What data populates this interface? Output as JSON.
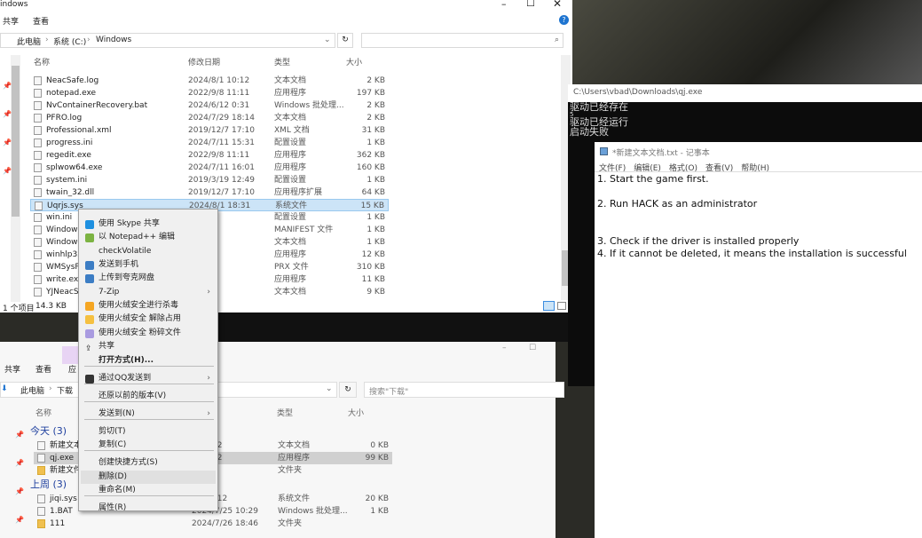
{
  "top_explorer": {
    "title": "indows",
    "ribbon_tabs": [
      "共享",
      "查看"
    ],
    "breadcrumb": [
      "此电脑",
      "系统 (C:)",
      "Windows"
    ],
    "columns": {
      "name": "名称",
      "date": "修改日期",
      "type": "类型",
      "size": "大小"
    },
    "files": [
      {
        "name": "NeacSafe.log",
        "date": "2024/8/1 10:12",
        "type": "文本文档",
        "size": "2 KB"
      },
      {
        "name": "notepad.exe",
        "date": "2022/9/8 11:11",
        "type": "应用程序",
        "size": "197 KB"
      },
      {
        "name": "NvContainerRecovery.bat",
        "date": "2024/6/12 0:31",
        "type": "Windows 批处理...",
        "size": "2 KB"
      },
      {
        "name": "PFRO.log",
        "date": "2024/7/29 18:14",
        "type": "文本文档",
        "size": "2 KB"
      },
      {
        "name": "Professional.xml",
        "date": "2019/12/7 17:10",
        "type": "XML 文档",
        "size": "31 KB"
      },
      {
        "name": "progress.ini",
        "date": "2024/7/11 15:31",
        "type": "配置设置",
        "size": "1 KB"
      },
      {
        "name": "regedit.exe",
        "date": "2022/9/8 11:11",
        "type": "应用程序",
        "size": "362 KB"
      },
      {
        "name": "splwow64.exe",
        "date": "2024/7/11 16:01",
        "type": "应用程序",
        "size": "160 KB"
      },
      {
        "name": "system.ini",
        "date": "2019/3/19 12:49",
        "type": "配置设置",
        "size": "1 KB"
      },
      {
        "name": "twain_32.dll",
        "date": "2019/12/7 17:10",
        "type": "应用程序扩展",
        "size": "64 KB"
      },
      {
        "name": "Uqrjs.sys",
        "date": "2024/8/1 18:31",
        "type": "系统文件",
        "size": "15 KB"
      },
      {
        "name": "win.ini",
        "date": "9 12:49",
        "type": "配置设置",
        "size": "1 KB"
      },
      {
        "name": "Windows",
        "date": "7 17:09",
        "type": "MANIFEST 文件",
        "size": "1 KB"
      },
      {
        "name": "Windows",
        "date": "16:41",
        "type": "文本文档",
        "size": "1 KB"
      },
      {
        "name": "winhlp32.",
        "date": "7 17:10",
        "type": "应用程序",
        "size": "12 KB"
      },
      {
        "name": "WMSysPr",
        "date": "7 22:46",
        "type": "PRX 文件",
        "size": "310 KB"
      },
      {
        "name": "write.exe",
        "date": "7 5:29",
        "type": "应用程序",
        "size": "11 KB"
      },
      {
        "name": "YJNeacSa",
        "date": "10:40",
        "type": "文本文档",
        "size": "9 KB"
      }
    ],
    "status": {
      "count": "1 个项目",
      "size": "14.3 KB"
    }
  },
  "context_menu": [
    "使用 Skype 共享",
    "以 Notepad++ 编辑",
    "checkVolatile",
    "发送到手机",
    "上传到夸克网盘",
    "7-Zip",
    "使用火绒安全进行杀毒",
    "使用火绒安全 解除占用",
    "使用火绒安全 粉碎文件",
    "共享",
    "打开方式(H)...",
    "通过QQ发送到",
    "还原以前的版本(V)",
    "发送到(N)",
    "剪切(T)",
    "复制(C)",
    "创建快捷方式(S)",
    "删除(D)",
    "重命名(M)",
    "属性(R)"
  ],
  "bottom_explorer": {
    "ribbon_tabs": [
      "共享",
      "查看",
      "应"
    ],
    "breadcrumb": [
      "此电脑",
      "下载"
    ],
    "search_placeholder": "搜索\"下载\"",
    "columns": {
      "name": "名称",
      "type": "类型",
      "size": "大小"
    },
    "groups": [
      {
        "label": "今天 (3)",
        "files": [
          {
            "name": "新建文本",
            "date": "1 18:32",
            "type": "文本文档",
            "size": "0 KB"
          },
          {
            "name": "qj.exe",
            "date": "1 18:32",
            "type": "应用程序",
            "size": "99 KB"
          },
          {
            "name": "新建文件",
            "date": "1 7:31",
            "type": "文件夹",
            "size": ""
          }
        ]
      },
      {
        "label": "上周 (3)",
        "files": [
          {
            "name": "jiqi.sys",
            "date": "25 11:12",
            "type": "系统文件",
            "size": "20 KB"
          },
          {
            "name": "1.BAT",
            "date": "2024/7/25 10:29",
            "type": "Windows 批处理...",
            "size": "1 KB"
          },
          {
            "name": "111",
            "date": "2024/7/26 18:46",
            "type": "文件夹",
            "size": ""
          }
        ]
      }
    ]
  },
  "console": {
    "title": "C:\\Users\\vbad\\Downloads\\qj.exe",
    "lines": [
      "驱动已经存在",
      "5",
      "驱动已经运行",
      "启动失败"
    ]
  },
  "notepad": {
    "title": "*新建文本文档.txt - 记事本",
    "menu": [
      "文件(F)",
      "编辑(E)",
      "格式(O)",
      "查看(V)",
      "帮助(H)"
    ],
    "lines": [
      "1. Start the game first.",
      "",
      "2. Run HACK as an administrator",
      "",
      "",
      "3. Check if the driver is installed properly",
      "4. If it cannot be deleted, it means the installation is successful"
    ]
  }
}
